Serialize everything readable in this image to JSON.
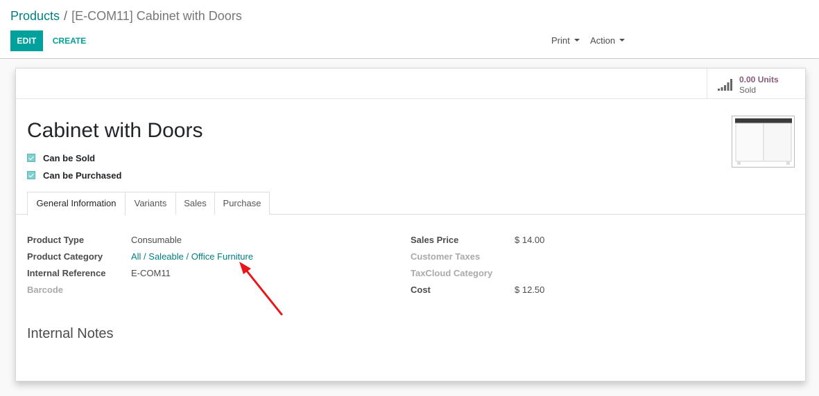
{
  "breadcrumb": {
    "parent": "Products",
    "separator": "/",
    "current": "[E-COM11] Cabinet with Doors"
  },
  "toolbar": {
    "edit_label": "EDIT",
    "create_label": "CREATE",
    "print_label": "Print",
    "action_label": "Action"
  },
  "stat": {
    "value": "0.00 Units",
    "label": "Sold",
    "icon": "bar-chart-icon"
  },
  "product": {
    "name": "Cabinet with Doors",
    "can_be_sold_label": "Can be Sold",
    "can_be_sold": true,
    "can_be_purchased_label": "Can be Purchased",
    "can_be_purchased": true
  },
  "tabs": [
    {
      "label": "General Information",
      "active": true
    },
    {
      "label": "Variants",
      "active": false
    },
    {
      "label": "Sales",
      "active": false
    },
    {
      "label": "Purchase",
      "active": false
    }
  ],
  "general": {
    "left": [
      {
        "label": "Product Type",
        "value": "Consumable"
      },
      {
        "label": "Product Category",
        "value": "All / Saleable / Office Furniture"
      },
      {
        "label": "Internal Reference",
        "value": "E-COM11"
      },
      {
        "label": "Barcode",
        "value": ""
      }
    ],
    "right": [
      {
        "label": "Sales Price",
        "value": "$ 14.00"
      },
      {
        "label": "Customer Taxes",
        "value": ""
      },
      {
        "label": "TaxCloud Category",
        "value": ""
      },
      {
        "label": "Cost",
        "value": "$ 12.50"
      }
    ]
  },
  "notes": {
    "title": "Internal Notes"
  },
  "colors": {
    "accent": "#00a09d",
    "link": "#017e84",
    "stat": "#875a7b",
    "annotation_arrow": "#e8161b"
  }
}
